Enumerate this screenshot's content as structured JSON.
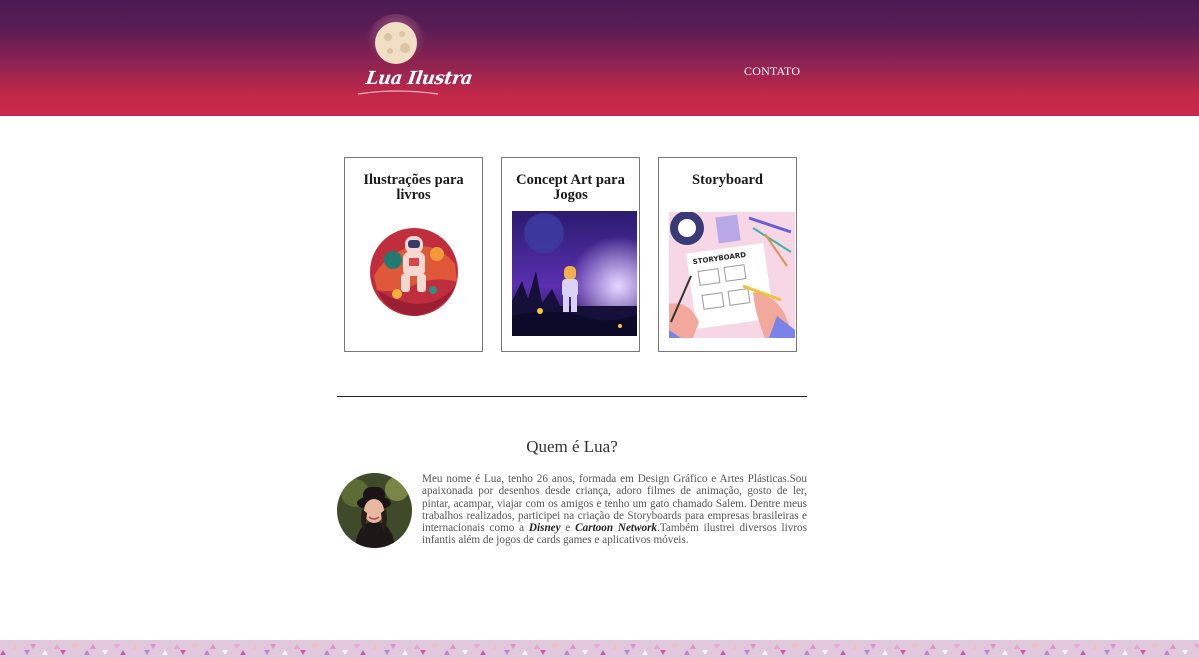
{
  "header": {
    "logo_text": "Lua Ilustra",
    "nav": {
      "contato": "CONTATO"
    }
  },
  "cards": [
    {
      "title": "Ilustrações para livros",
      "image": "astronaut-planet-illustration"
    },
    {
      "title": "Concept Art para Jogos",
      "image": "space-landscape-astronaut-illustration"
    },
    {
      "title": "Storyboard",
      "image": "storyboard-drawing-illustration"
    }
  ],
  "about": {
    "title": "Quem é Lua?",
    "text_1": "Meu nome é Lua, tenho 26 anos, formada em Design Gráfico e Artes Plásticas.Sou apaixonada por desenhos desde criança, adoro filmes de animação, gosto de ler, pintar, acampar, viajar com os amigos e tenho um gato chamado Salem. Dentre meus trabalhos realizados, participei na criação de Storyboards para empresas brasileiras e internacionais como a ",
    "brand_1": "Disney",
    "text_2": " e ",
    "brand_2": "Cartoon Network",
    "text_3": ".Também ilustrei diversos livros infantis além de jogos de cards games e aplicativos móveis."
  },
  "colors": {
    "header_top": "#4a1a52",
    "header_bottom": "#c9294a",
    "footer_pattern": "#e2c8dc"
  }
}
